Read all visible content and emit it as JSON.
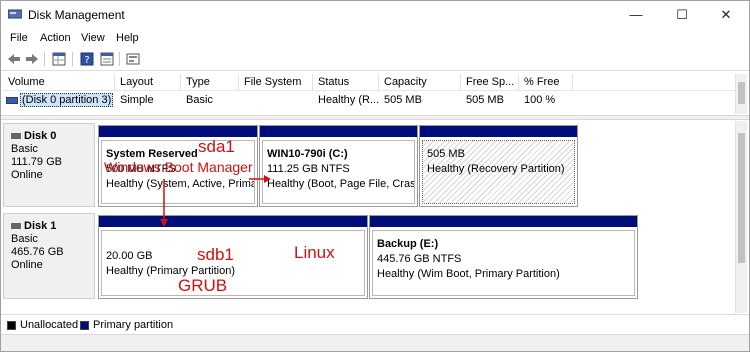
{
  "window": {
    "title": "Disk Management",
    "controls": {
      "minimize": "—",
      "maximize": "☐",
      "close": "✕"
    }
  },
  "menu": [
    "File",
    "Action",
    "View",
    "Help"
  ],
  "toolbar": {
    "icons": [
      "back-arrow-icon",
      "forward-arrow-icon",
      "grid-view-icon",
      "help-icon",
      "properties-icon",
      "console-icon"
    ]
  },
  "volume_list": {
    "columns": [
      "Volume",
      "Layout",
      "Type",
      "File System",
      "Status",
      "Capacity",
      "Free Sp...",
      "% Free"
    ],
    "rows": [
      {
        "volume": "(Disk 0 partition 3)",
        "layout": "Simple",
        "type": "Basic",
        "file_system": "",
        "status": "Healthy (R...",
        "capacity": "505 MB",
        "free_space": "505 MB",
        "percent_free": "100 %"
      }
    ]
  },
  "disks": [
    {
      "name": "Disk 0",
      "type": "Basic",
      "size": "111.79 GB",
      "status": "Online",
      "partitions": [
        {
          "name": "System Reserved",
          "detail": "500 MB NTFS",
          "health": "Healthy (System, Active, Primar"
        },
        {
          "name": "WIN10-790i  (C:)",
          "detail": "111.25 GB NTFS",
          "health": "Healthy (Boot, Page File, Crash D"
        },
        {
          "name": "",
          "detail": "505 MB",
          "health": "Healthy (Recovery Partition)"
        }
      ]
    },
    {
      "name": "Disk 1",
      "type": "Basic",
      "size": "465.76 GB",
      "status": "Online",
      "partitions": [
        {
          "name": "",
          "detail": "20.00 GB",
          "health": "Healthy (Primary Partition)"
        },
        {
          "name": "Backup  (E:)",
          "detail": "445.76 GB NTFS",
          "health": "Healthy (Wim Boot, Primary Partition)"
        }
      ]
    }
  ],
  "legend": {
    "unallocated": {
      "label": "Unallocated",
      "color": "#000000"
    },
    "primary": {
      "label": "Primary partition",
      "color": "#000e7a"
    }
  },
  "annotations": {
    "sda1": "sda1",
    "windows_boot_manager": "Windows Boot Manager",
    "sdb1": "sdb1",
    "linux": "Linux",
    "grub": "GRUB",
    "color": "#d01010"
  },
  "colors": {
    "partition_bar": "#000e7a",
    "selection": "#cce4f7"
  }
}
